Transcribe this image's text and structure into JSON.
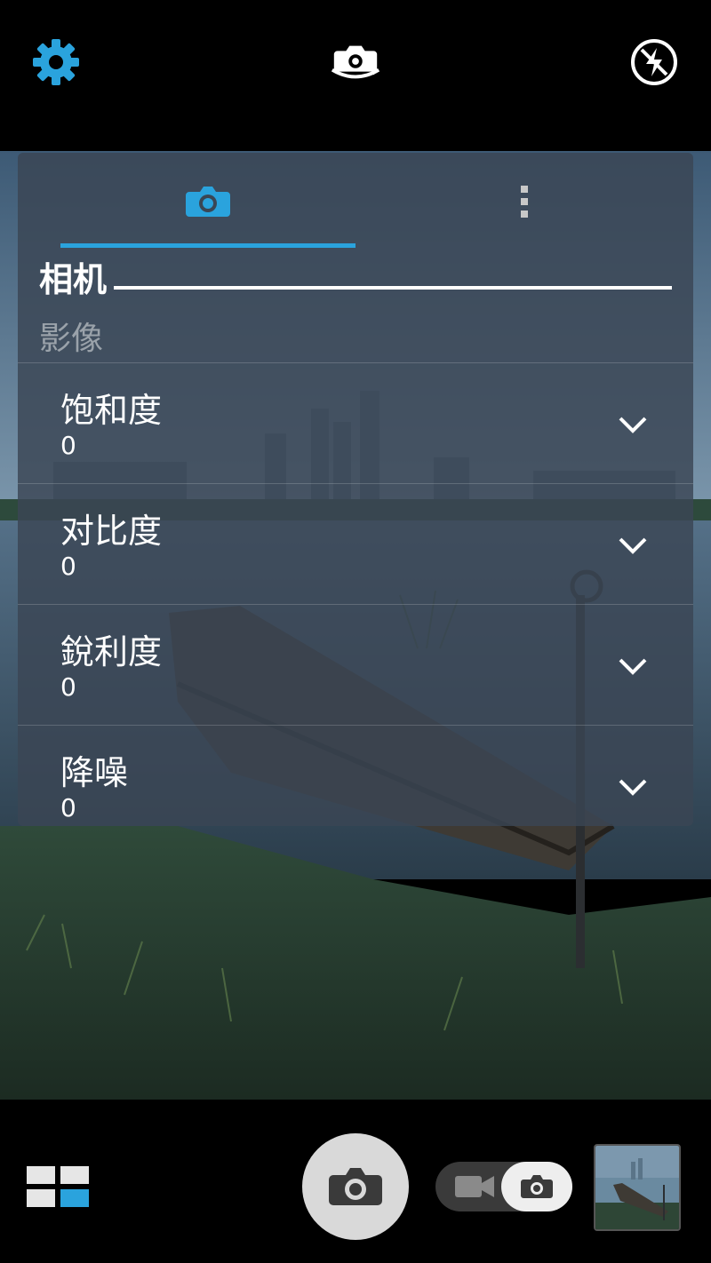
{
  "top_bar": {
    "icons": [
      "gear-icon",
      "switch-camera-icon",
      "flash-off-icon"
    ],
    "accent_color": "#2aa3dd"
  },
  "settings_panel": {
    "tabs": [
      {
        "icon": "camera-icon",
        "active": true
      },
      {
        "icon": "more-vertical-icon",
        "active": false
      }
    ],
    "section_title": "相机",
    "section_subtitle": "影像",
    "items": [
      {
        "label": "饱和度",
        "value": "0"
      },
      {
        "label": "对比度",
        "value": "0"
      },
      {
        "label": "銳利度",
        "value": "0"
      },
      {
        "label": "降噪",
        "value": "0"
      }
    ]
  },
  "bottom_bar": {
    "icons": [
      "mode-grid-icon",
      "shutter-camera-icon",
      "video-icon",
      "photo-toggle-icon",
      "gallery-thumbnail"
    ],
    "mode": "photo"
  }
}
